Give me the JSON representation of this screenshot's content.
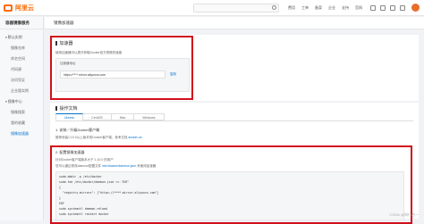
{
  "topbar": {
    "brand": "阿里云",
    "nav": [
      "费用",
      "工单",
      "备案",
      "企业",
      "支持",
      "官网"
    ]
  },
  "sidebar": {
    "title": "容器镜像服务",
    "groups": [
      {
        "label": "默认实例",
        "items": [
          "镜像仓库",
          "命名空间",
          "代码源",
          "访问凭证",
          "企业版实例"
        ],
        "active": null
      },
      {
        "label": "镜像中心",
        "items": [
          "镜像搜索",
          "我的收藏",
          "镜像加速器"
        ],
        "active": 2
      }
    ]
  },
  "page": {
    "title": "镜像加速器"
  },
  "accelerator": {
    "title": "加速器",
    "desc": "使用加速器可以提升获取Docker官方镜像的速度",
    "box_label": "加速器地址",
    "address": "https://****.mirror.aliyuncs.com",
    "copy": "复制"
  },
  "docs": {
    "title": "操作文档",
    "tabs": [
      "Ubuntu",
      "CentOS",
      "Mac",
      "Windows"
    ],
    "active_tab": 0,
    "install_title": "1. 安装／升级Docker客户端",
    "install_text": "推荐安装1.10.0以上版本的Docker客户端，参考文档",
    "install_link": "docker-ce"
  },
  "configure": {
    "title": "2. 配置镜像加速器",
    "line1": "针对Docker客户端版本大于 1.10.0 的用户",
    "line2_text": "您可以通过修改daemon配置文件",
    "line2_path": "/etc/docker/daemon.json",
    "line2_tail": "来使用加速器",
    "code": [
      "sudo mkdir -p /etc/docker",
      "sudo tee /etc/docker/daemon.json <<-'EOF'",
      "{",
      "  \"registry-mirrors\": [\"https://****.mirror.aliyuncs.com\"]",
      "}",
      "EOF",
      "sudo systemctl daemon-reload",
      "sudo systemctl restart docker"
    ]
  },
  "watermark": "CSDN @知行合一"
}
